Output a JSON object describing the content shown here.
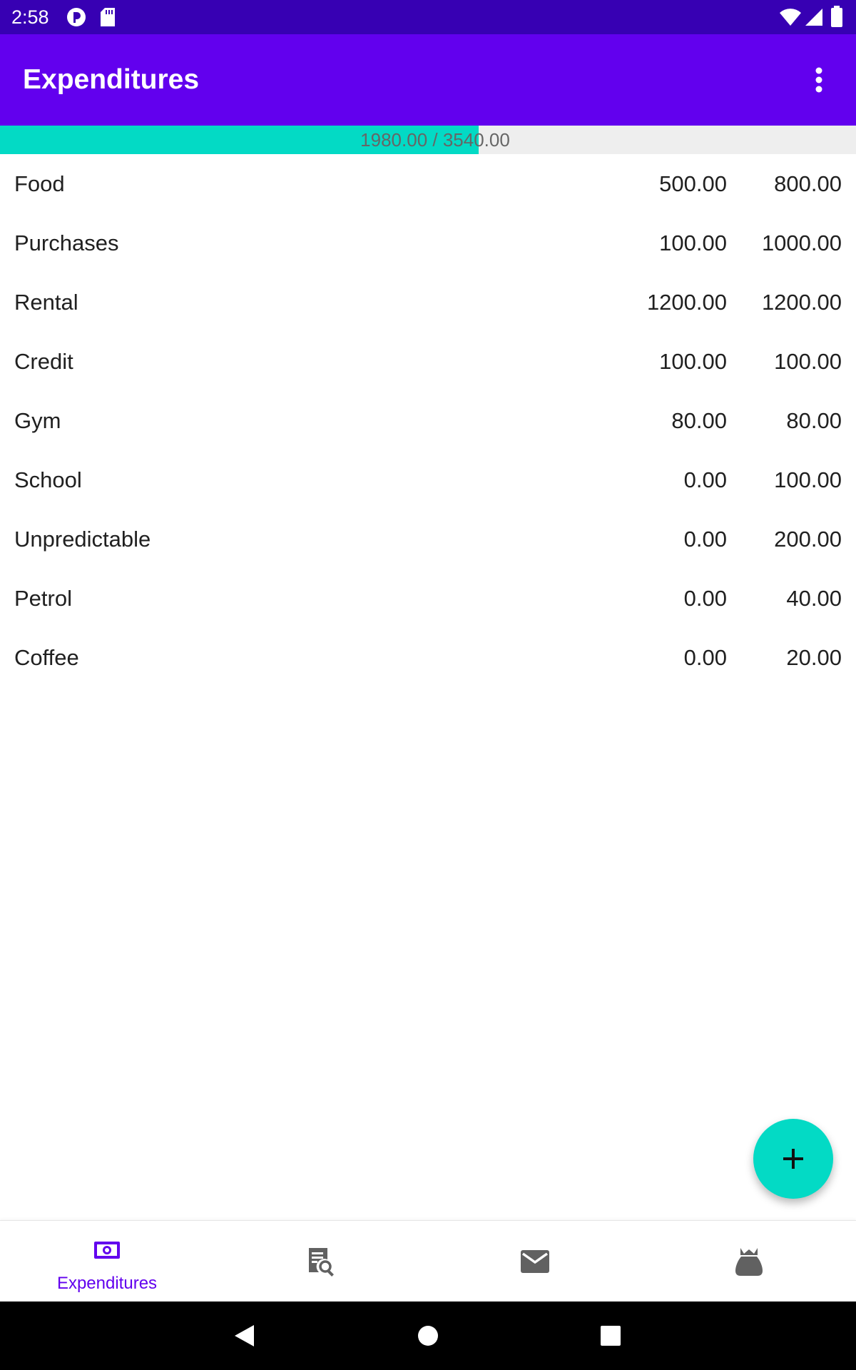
{
  "status_bar": {
    "time": "2:58",
    "icons": [
      "privacy-indicator-icon",
      "sd-card-icon",
      "wifi-icon",
      "cell-signal-icon",
      "battery-icon"
    ]
  },
  "app_bar": {
    "title": "Expenditures",
    "menu_icon": "more-vert-icon"
  },
  "budget_progress": {
    "text": "1980.00 / 3540.00",
    "spent": 1980.0,
    "total": 3540.0,
    "fill_color": "#03dac5"
  },
  "expenses": [
    {
      "name": "Food",
      "spent": "500.00",
      "budget": "800.00"
    },
    {
      "name": "Purchases",
      "spent": "100.00",
      "budget": "1000.00"
    },
    {
      "name": "Rental",
      "spent": "1200.00",
      "budget": "1200.00"
    },
    {
      "name": "Credit",
      "spent": "100.00",
      "budget": "100.00"
    },
    {
      "name": "Gym",
      "spent": "80.00",
      "budget": "80.00"
    },
    {
      "name": "School",
      "spent": "0.00",
      "budget": "100.00"
    },
    {
      "name": "Unpredictable",
      "spent": "0.00",
      "budget": "200.00"
    },
    {
      "name": "Petrol",
      "spent": "0.00",
      "budget": "40.00"
    },
    {
      "name": "Coffee",
      "spent": "0.00",
      "budget": "20.00"
    }
  ],
  "fab": {
    "icon": "add-icon",
    "color": "#03dac5"
  },
  "bottom_nav": {
    "items": [
      {
        "label": "Expenditures",
        "icon": "money-icon",
        "selected": true
      },
      {
        "label": "",
        "icon": "receipt-search-icon",
        "selected": false
      },
      {
        "label": "",
        "icon": "mail-icon",
        "selected": false
      },
      {
        "label": "",
        "icon": "money-bag-icon",
        "selected": false
      }
    ]
  },
  "system_nav": {
    "icons": [
      "back-icon",
      "home-icon",
      "recents-icon"
    ]
  },
  "colors": {
    "primary": "#6200ee",
    "primary_dark": "#3700b3",
    "accent": "#03dac5"
  }
}
